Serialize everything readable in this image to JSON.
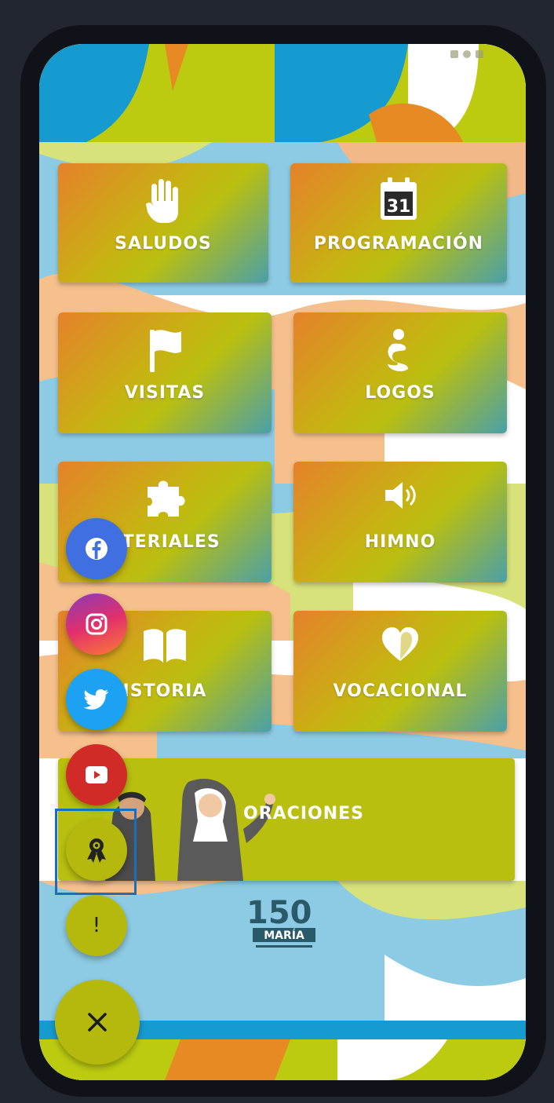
{
  "colors": {
    "accent": "#b5b90e",
    "tile_gradient": [
      "#e5812a",
      "#b9bf0f",
      "#4aa0a8"
    ],
    "facebook": "#3f6fe0",
    "twitter": "#1da1f2",
    "youtube": "#d02b26"
  },
  "menu": {
    "tiles": [
      {
        "label": "SALUDOS",
        "icon": "hand-icon"
      },
      {
        "label": "PROGRAMACIÓN",
        "icon": "calendar-31-icon",
        "icon_text": "31"
      },
      {
        "label": "VISITAS",
        "icon": "flag-icon"
      },
      {
        "label": "LOGOS",
        "icon": "logo-figure-icon"
      },
      {
        "label": "ATERIALES",
        "icon": "puzzle-icon"
      },
      {
        "label": "HIMNO",
        "icon": "speaker-icon"
      },
      {
        "label": "ISTORIA",
        "icon": "open-book-icon"
      },
      {
        "label": "VOCACIONAL",
        "icon": "heart-icon"
      }
    ],
    "wide": {
      "label": "ORACIONES",
      "image": "saints-illustration"
    }
  },
  "fab": {
    "social": [
      {
        "name": "facebook",
        "icon": "facebook-icon"
      },
      {
        "name": "instagram",
        "icon": "instagram-icon"
      },
      {
        "name": "twitter",
        "icon": "twitter-icon"
      },
      {
        "name": "youtube",
        "icon": "youtube-icon"
      }
    ],
    "award_icon": "award-ribbon-icon",
    "info_label": "!",
    "close_label": "×"
  },
  "footer_logo": {
    "text": "150",
    "word": "MARÍA"
  }
}
